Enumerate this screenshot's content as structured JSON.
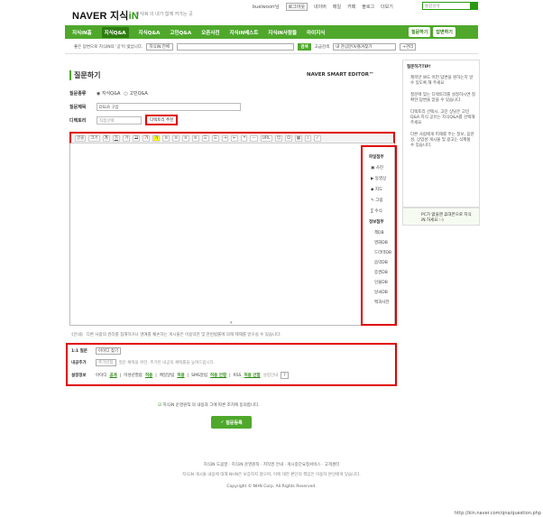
{
  "brand": {
    "logo_main": "NAVER",
    "logo_sub": "지식",
    "logo_in": "iN",
    "slogan": "지식iN 의 내가 함께 커가는 곳"
  },
  "topnav": {
    "user": "buelwoorr님",
    "logout": "로그아웃",
    "items": [
      "네이버",
      "메일",
      "카페",
      "블로그",
      "더보기"
    ],
    "search_placeholder": "통합검색"
  },
  "gnb": {
    "items": [
      "지식iN홈",
      "지식Q&A",
      "지식Q&A",
      "고민Q&A",
      "오픈사전",
      "지식iN베스트",
      "지식iN사람들",
      "마이지식"
    ],
    "active_index": 1,
    "right_buttons": [
      "질문하기",
      "답변하기"
    ]
  },
  "subbar": {
    "promo": "좋은 답변으로 지식iN의 '공'이 빛납니다.",
    "scope": "지식iN 전체",
    "search_btn": "검색",
    "advanced": "고급검색",
    "interest": "내 관심분야/즐겨찾기",
    "manage": "+관리"
  },
  "page": {
    "title": "질문하기",
    "editor_brand": "NAVER SMART EDITOR™"
  },
  "form": {
    "type_label": "질문종류",
    "type_options": [
      "지식Q&A",
      "고민Q&A"
    ],
    "title_label": "질문제목",
    "title_value": "DSLR 구입",
    "dir_label": "디렉토리",
    "dir_placeholder": "직접선택",
    "dir_btn": "디렉토리 추천"
  },
  "toolbar": {
    "items": [
      "글꼴",
      "크기",
      "가",
      "가",
      "가",
      "가",
      "가",
      "가",
      "URL"
    ]
  },
  "attach": {
    "heading": "파일첨부",
    "items": [
      "사진",
      "동영상",
      "지도",
      "그림",
      "수식"
    ],
    "info_heading": "정보첨부",
    "info_items": [
      "책DB",
      "영화DB",
      "드라마DB",
      "음악DB",
      "증권DB",
      "인물DB",
      "날씨DB",
      "백과사전"
    ]
  },
  "notice": "《안내》 다른 사람의 권리를 침해하거나 명예를 훼손하는 게시물은 이용약관 및 관련법률에 의해 제재를 받으실 수 있습니다.",
  "options": {
    "one_label": "1:1 질문",
    "one_btn": "아이디 찾기",
    "bonus_label": "내공추가",
    "bonus_value": "추가안함",
    "bonus_note": "질문 채택을 위한, 추가된 내공의 채택률을 높여드립니다.",
    "settings_label": "설정정보",
    "id_label": "아이디",
    "id_val": "공개",
    "minor_label": "미성년열람",
    "minor_val": "허용",
    "mail_label": "메일알림",
    "mail_val": "허용",
    "sms_label": "SMS알림",
    "sms_val": "허용 안함",
    "rss_label": "RSS",
    "rss_val": "허용 안함",
    "set_label": "설정안내"
  },
  "agree": "지식iN 운영원칙 의 내용과 그에 따른 조치에 동의합니다.",
  "submit": "질문등록",
  "footer": {
    "links": "지식iN 도움말 · 지식iN 운영원칙 · 저작권 안내 · 게시중단요청서비스 · 고객센터",
    "disclaimer": "지식iN 게시물 내용에 대해 NHN은 보증하지 않으며, 이에 대한 판단의 책임은 이용자 본인에게 있습니다.",
    "copyright": "Copyright © NHN Corp. All Rights Reserved."
  },
  "rside": {
    "title": "질문하기TIP!",
    "tips": [
      "제목만 봐도 어떤 답변을 원하는지 알 수 있도록 해 주세요",
      "질문에 맞는 디렉토리를 설정하시면 정확한 답변을 얻을 수 있습니다.",
      "디렉토리 선택시, 고민 상담은 고민Q&A 지식 공유는 지식Q&A를 선택해 주세요",
      "다른 사람에게 피해를 주는 정보, 음란성, 상업성 게시물 및 광고는 삭제될 수 있습니다."
    ],
    "pc_text": "PC가 없을땐 휴대폰으로 지식iN 하세요 :-)"
  },
  "url": "http://kin.naver.com/qna/question.php"
}
